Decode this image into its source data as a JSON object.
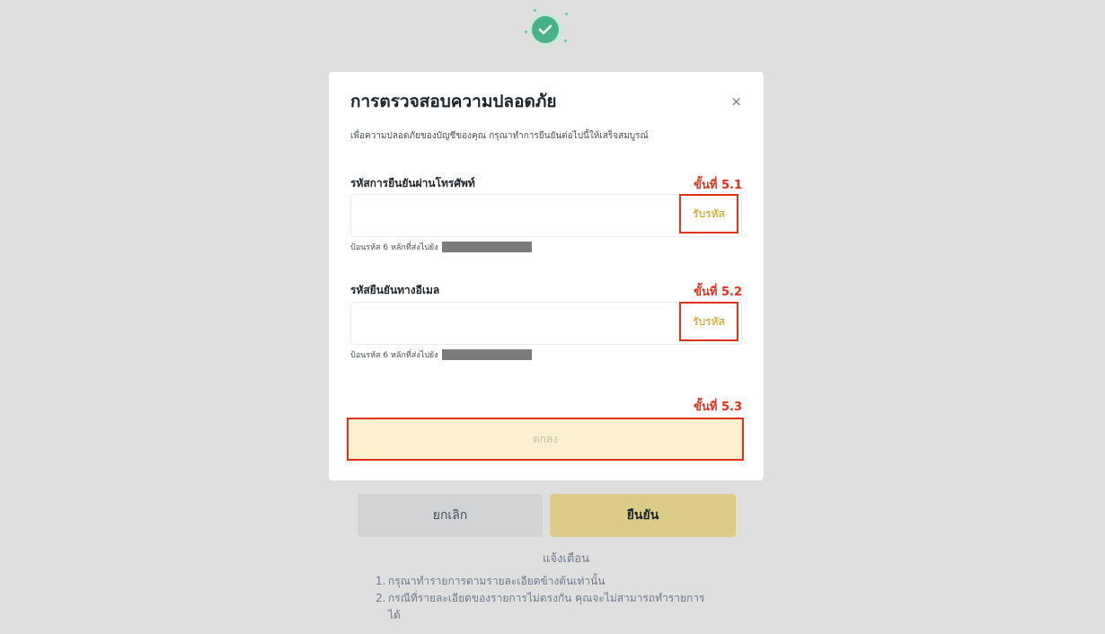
{
  "modal": {
    "title": "การตรวจสอบความปลอดภัย",
    "close_icon": "×",
    "subtitle": "เพื่อความปลอดภัยของบัญชีของคุณ กรุณาทำการยืนยันต่อไปนี้ให้เสร็จสมบูรณ์",
    "phone": {
      "label": "รหัสการยืนยันผ่านโทรศัพท์",
      "step": "ขั้นที่ 5.1",
      "value": "",
      "get_code_label": "รับรหัส",
      "hint": "ป้อนรหัส 6 หลักที่ส่งไปยัง"
    },
    "email": {
      "label": "รหัสยืนยันทางอีเมล",
      "step": "ขั้นที่ 5.2",
      "value": "",
      "get_code_label": "รับรหัส",
      "hint": "ป้อนรหัส 6 หลักที่ส่งไปยัง"
    },
    "submit": {
      "step": "ขั้นที่ 5.3",
      "label": "ตกลง"
    }
  },
  "background": {
    "cancel_label": "ยกเลิก",
    "confirm_label": "ยืนยัน",
    "notice_title": "แจ้งเตือน",
    "notices": [
      {
        "num": "1.",
        "text": "กรุณาทำรายการตามรายละเอียดข้างต้นเท่านั้น"
      },
      {
        "num": "2.",
        "text": "กรณีที่รายละเอียดของรายการไม่ตรงกัน คุณจะไม่สามารถทำรายการได้"
      }
    ]
  },
  "colors": {
    "accent_red": "#e0311c",
    "gold": "#c99400",
    "success_green": "#47b287"
  },
  "icons": {
    "success": "check-circle-icon",
    "close": "close-icon"
  }
}
